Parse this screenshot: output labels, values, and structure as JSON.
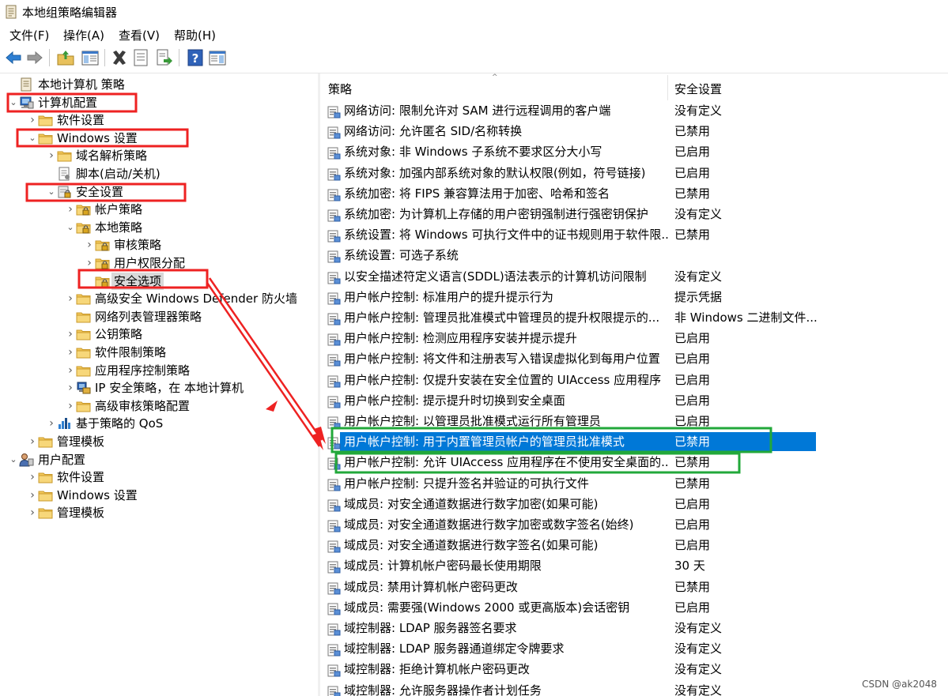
{
  "window": {
    "title": "本地组策略编辑器"
  },
  "menu": [
    {
      "label": "文件(F)"
    },
    {
      "label": "操作(A)"
    },
    {
      "label": "查看(V)"
    },
    {
      "label": "帮助(H)"
    }
  ],
  "toolbar": [
    {
      "name": "back-button",
      "icon": "arrow-left-icon"
    },
    {
      "name": "forward-button",
      "icon": "arrow-right-icon"
    },
    {
      "name": "up-folder-button",
      "icon": "folder-up-icon"
    },
    {
      "name": "show-hide-tree-button",
      "icon": "console-tree-icon"
    },
    {
      "name": "delete-button",
      "icon": "delete-x-icon"
    },
    {
      "name": "properties-button",
      "icon": "properties-icon"
    },
    {
      "name": "export-list-button",
      "icon": "export-icon"
    },
    {
      "name": "help-button",
      "icon": "help-icon"
    },
    {
      "name": "show-action-pane-button",
      "icon": "action-pane-icon"
    }
  ],
  "tree": [
    {
      "label": "本地计算机 策略",
      "level": 0,
      "expander": "",
      "icon": "policy-doc-icon"
    },
    {
      "label": "计算机配置",
      "level": 0,
      "expander": "expanded",
      "icon": "computer-icon"
    },
    {
      "label": "软件设置",
      "level": 1,
      "expander": "collapsed",
      "icon": "folder-icon"
    },
    {
      "label": "Windows 设置",
      "level": 1,
      "expander": "expanded",
      "icon": "folder-icon"
    },
    {
      "label": "域名解析策略",
      "level": 2,
      "expander": "collapsed",
      "icon": "folder-icon"
    },
    {
      "label": "脚本(启动/关机)",
      "level": 2,
      "expander": "",
      "icon": "script-icon"
    },
    {
      "label": "安全设置",
      "level": 2,
      "expander": "expanded",
      "icon": "security-settings-icon"
    },
    {
      "label": "帐户策略",
      "level": 3,
      "expander": "collapsed",
      "icon": "locked-folder-icon"
    },
    {
      "label": "本地策略",
      "level": 3,
      "expander": "expanded",
      "icon": "locked-folder-icon"
    },
    {
      "label": "审核策略",
      "level": 4,
      "expander": "collapsed",
      "icon": "locked-folder-icon"
    },
    {
      "label": "用户权限分配",
      "level": 4,
      "expander": "collapsed",
      "icon": "locked-folder-icon"
    },
    {
      "label": "安全选项",
      "level": 4,
      "expander": "",
      "icon": "locked-folder-icon",
      "selected": true
    },
    {
      "label": "高级安全 Windows Defender 防火墙",
      "level": 3,
      "expander": "collapsed",
      "icon": "folder-icon"
    },
    {
      "label": "网络列表管理器策略",
      "level": 3,
      "expander": "",
      "icon": "folder-icon"
    },
    {
      "label": "公钥策略",
      "level": 3,
      "expander": "collapsed",
      "icon": "folder-icon"
    },
    {
      "label": "软件限制策略",
      "level": 3,
      "expander": "collapsed",
      "icon": "folder-icon"
    },
    {
      "label": "应用程序控制策略",
      "level": 3,
      "expander": "collapsed",
      "icon": "folder-icon"
    },
    {
      "label": "IP 安全策略，在 本地计算机",
      "level": 3,
      "expander": "collapsed",
      "icon": "ip-security-icon"
    },
    {
      "label": "高级审核策略配置",
      "level": 3,
      "expander": "collapsed",
      "icon": "folder-icon"
    },
    {
      "label": "基于策略的 QoS",
      "level": 2,
      "expander": "collapsed",
      "icon": "qos-chart-icon"
    },
    {
      "label": "管理模板",
      "level": 1,
      "expander": "collapsed",
      "icon": "folder-icon"
    },
    {
      "label": "用户配置",
      "level": 0,
      "expander": "expanded",
      "icon": "user-icon"
    },
    {
      "label": "软件设置",
      "level": 1,
      "expander": "collapsed",
      "icon": "folder-icon"
    },
    {
      "label": "Windows 设置",
      "level": 1,
      "expander": "collapsed",
      "icon": "folder-icon"
    },
    {
      "label": "管理模板",
      "level": 1,
      "expander": "collapsed",
      "icon": "folder-icon"
    }
  ],
  "list": {
    "headers": {
      "policy": "策略",
      "setting": "安全设置"
    },
    "rows": [
      {
        "policy": "网络访问: 限制允许对 SAM 进行远程调用的客户端",
        "setting": "没有定义"
      },
      {
        "policy": "网络访问: 允许匿名 SID/名称转换",
        "setting": "已禁用"
      },
      {
        "policy": "系统对象: 非 Windows 子系统不要求区分大小写",
        "setting": "已启用"
      },
      {
        "policy": "系统对象: 加强内部系统对象的默认权限(例如，符号链接)",
        "setting": "已启用"
      },
      {
        "policy": "系统加密: 将 FIPS 兼容算法用于加密、哈希和签名",
        "setting": "已禁用"
      },
      {
        "policy": "系统加密: 为计算机上存储的用户密钥强制进行强密钥保护",
        "setting": "没有定义"
      },
      {
        "policy": "系统设置: 将 Windows 可执行文件中的证书规则用于软件限...",
        "setting": "已禁用"
      },
      {
        "policy": "系统设置: 可选子系统",
        "setting": ""
      },
      {
        "policy": "以安全描述符定义语言(SDDL)语法表示的计算机访问限制",
        "setting": "没有定义"
      },
      {
        "policy": "用户帐户控制: 标准用户的提升提示行为",
        "setting": "提示凭据"
      },
      {
        "policy": "用户帐户控制: 管理员批准模式中管理员的提升权限提示的...",
        "setting": "非 Windows 二进制文件..."
      },
      {
        "policy": "用户帐户控制: 检测应用程序安装并提示提升",
        "setting": "已启用"
      },
      {
        "policy": "用户帐户控制: 将文件和注册表写入错误虚拟化到每用户位置",
        "setting": "已启用"
      },
      {
        "policy": "用户帐户控制: 仅提升安装在安全位置的 UIAccess 应用程序",
        "setting": "已启用"
      },
      {
        "policy": "用户帐户控制: 提示提升时切换到安全桌面",
        "setting": "已启用"
      },
      {
        "policy": "用户帐户控制: 以管理员批准模式运行所有管理员",
        "setting": "已启用"
      },
      {
        "policy": "用户帐户控制: 用于内置管理员帐户的管理员批准模式",
        "setting": "已禁用",
        "selected": true
      },
      {
        "policy": "用户帐户控制: 允许 UIAccess 应用程序在不使用安全桌面的...",
        "setting": "已禁用"
      },
      {
        "policy": "用户帐户控制: 只提升签名并验证的可执行文件",
        "setting": "已禁用"
      },
      {
        "policy": "域成员: 对安全通道数据进行数字加密(如果可能)",
        "setting": "已启用"
      },
      {
        "policy": "域成员: 对安全通道数据进行数字加密或数字签名(始终)",
        "setting": "已启用"
      },
      {
        "policy": "域成员: 对安全通道数据进行数字签名(如果可能)",
        "setting": "已启用"
      },
      {
        "policy": "域成员: 计算机帐户密码最长使用期限",
        "setting": "30 天"
      },
      {
        "policy": "域成员: 禁用计算机帐户密码更改",
        "setting": "已禁用"
      },
      {
        "policy": "域成员: 需要强(Windows 2000 或更高版本)会话密钥",
        "setting": "已启用"
      },
      {
        "policy": "域控制器: LDAP 服务器签名要求",
        "setting": "没有定义"
      },
      {
        "policy": "域控制器: LDAP 服务器通道绑定令牌要求",
        "setting": "没有定义"
      },
      {
        "policy": "域控制器: 拒绝计算机帐户密码更改",
        "setting": "没有定义"
      },
      {
        "policy": "域控制器: 允许服务器操作者计划任务",
        "setting": "没有定义"
      }
    ]
  },
  "annotations": {
    "red": "#ee2222",
    "green": "#22a83a",
    "selection_blue": "#0078d7"
  },
  "watermark": "CSDN @ak2048"
}
